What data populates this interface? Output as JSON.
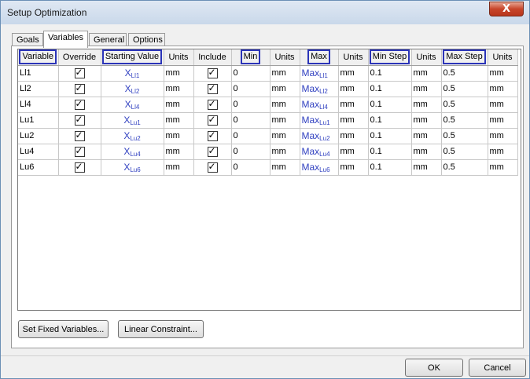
{
  "window": {
    "title": "Setup Optimization",
    "close_glyph": "X"
  },
  "tabs": [
    {
      "label": "Goals",
      "active": false
    },
    {
      "label": "Variables",
      "active": true
    },
    {
      "label": "General",
      "active": false
    },
    {
      "label": "Options",
      "active": false
    }
  ],
  "columns": [
    {
      "label": "Variable",
      "highlighted": true
    },
    {
      "label": "Override",
      "highlighted": false
    },
    {
      "label": "Starting Value",
      "highlighted": true
    },
    {
      "label": "Units",
      "highlighted": false
    },
    {
      "label": "Include",
      "highlighted": false
    },
    {
      "label": "Min",
      "highlighted": true
    },
    {
      "label": "Units",
      "highlighted": false
    },
    {
      "label": "Max",
      "highlighted": true
    },
    {
      "label": "Units",
      "highlighted": false
    },
    {
      "label": "Min Step",
      "highlighted": true
    },
    {
      "label": "Units",
      "highlighted": false
    },
    {
      "label": "Max Step",
      "highlighted": true
    },
    {
      "label": "Units",
      "highlighted": false
    }
  ],
  "rows": [
    {
      "variable": "Ll1",
      "override": true,
      "start_main": "X",
      "start_sub": "Ll1",
      "start_units": "mm",
      "include": true,
      "min": "0",
      "min_units": "mm",
      "max_main": "Max",
      "max_sub": "Ll1",
      "max_units": "mm",
      "min_step": "0.1",
      "min_step_units": "mm",
      "max_step": "0.5",
      "max_step_units": "mm"
    },
    {
      "variable": "Ll2",
      "override": true,
      "start_main": "X",
      "start_sub": "Ll2",
      "start_units": "mm",
      "include": true,
      "min": "0",
      "min_units": "mm",
      "max_main": "Max",
      "max_sub": "Ll2",
      "max_units": "mm",
      "min_step": "0.1",
      "min_step_units": "mm",
      "max_step": "0.5",
      "max_step_units": "mm"
    },
    {
      "variable": "Ll4",
      "override": true,
      "start_main": "X",
      "start_sub": "Ll4",
      "start_units": "mm",
      "include": true,
      "min": "0",
      "min_units": "mm",
      "max_main": "Max",
      "max_sub": "Ll4",
      "max_units": "mm",
      "min_step": "0.1",
      "min_step_units": "mm",
      "max_step": "0.5",
      "max_step_units": "mm"
    },
    {
      "variable": "Lu1",
      "override": true,
      "start_main": "X",
      "start_sub": "Lu1",
      "start_units": "mm",
      "include": true,
      "min": "0",
      "min_units": "mm",
      "max_main": "Max",
      "max_sub": "Lu1",
      "max_units": "mm",
      "min_step": "0.1",
      "min_step_units": "mm",
      "max_step": "0.5",
      "max_step_units": "mm"
    },
    {
      "variable": "Lu2",
      "override": true,
      "start_main": "X",
      "start_sub": "Lu2",
      "start_units": "mm",
      "include": true,
      "min": "0",
      "min_units": "mm",
      "max_main": "Max",
      "max_sub": "Lu2",
      "max_units": "mm",
      "min_step": "0.1",
      "min_step_units": "mm",
      "max_step": "0.5",
      "max_step_units": "mm"
    },
    {
      "variable": "Lu4",
      "override": true,
      "start_main": "X",
      "start_sub": "Lu4",
      "start_units": "mm",
      "include": true,
      "min": "0",
      "min_units": "mm",
      "max_main": "Max",
      "max_sub": "Lu4",
      "max_units": "mm",
      "min_step": "0.1",
      "min_step_units": "mm",
      "max_step": "0.5",
      "max_step_units": "mm"
    },
    {
      "variable": "Lu6",
      "override": true,
      "start_main": "X",
      "start_sub": "Lu6",
      "start_units": "mm",
      "include": true,
      "min": "0",
      "min_units": "mm",
      "max_main": "Max",
      "max_sub": "Lu6",
      "max_units": "mm",
      "min_step": "0.1",
      "min_step_units": "mm",
      "max_step": "0.5",
      "max_step_units": "mm"
    }
  ],
  "buttons": {
    "set_fixed": "Set Fixed Variables...",
    "linear_constraint": "Linear Constraint...",
    "ok": "OK",
    "cancel": "Cancel"
  },
  "colors": {
    "highlight_border": "#2b34b8",
    "value_text": "#3040c0"
  }
}
